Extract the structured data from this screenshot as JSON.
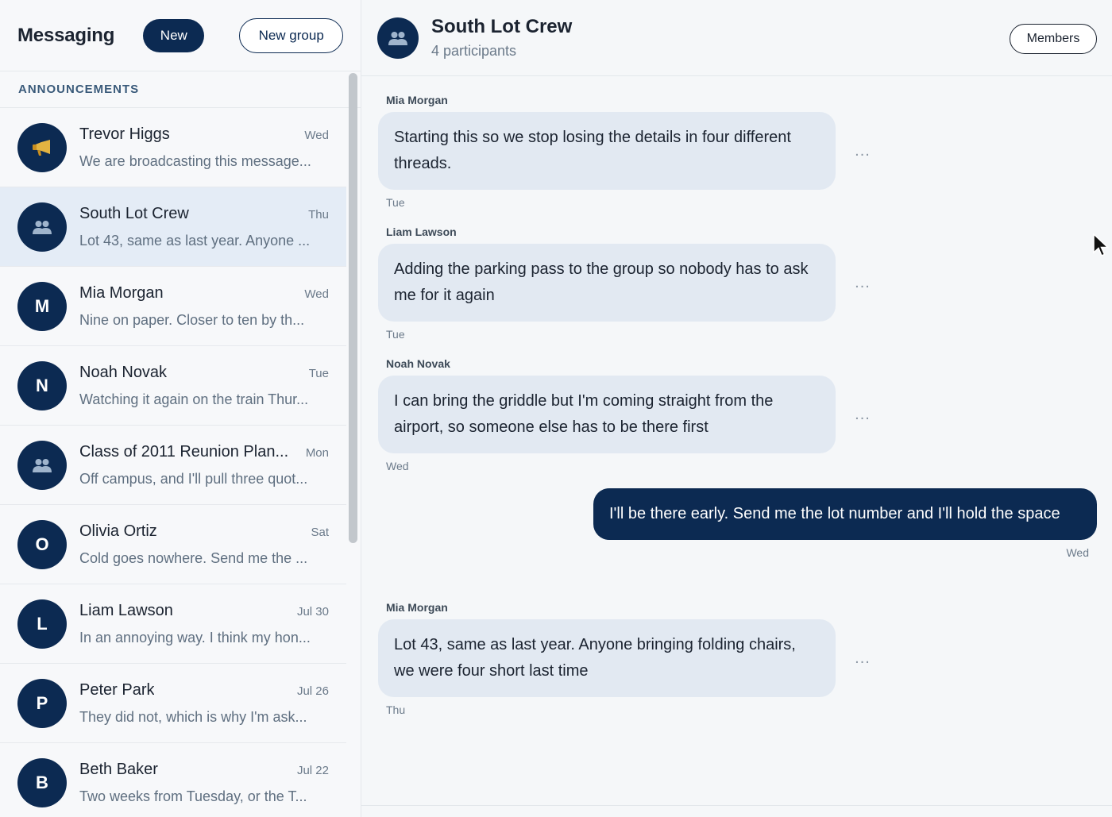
{
  "sidebar": {
    "title": "Messaging",
    "new_label": "New",
    "new_group_label": "New group",
    "section_label": "ANNOUNCEMENTS",
    "conversations": [
      {
        "name": "Trevor Higgs",
        "time": "Wed",
        "preview": "We are broadcasting this message...",
        "avatar": "megaphone-icon",
        "initial": ""
      },
      {
        "name": "South Lot Crew",
        "time": "Thu",
        "preview": "Lot 43, same as last year. Anyone ...",
        "avatar": "group-icon",
        "initial": "",
        "active": true
      },
      {
        "name": "Mia Morgan",
        "time": "Wed",
        "preview": "Nine on paper. Closer to ten by th...",
        "avatar": "letter",
        "initial": "M"
      },
      {
        "name": "Noah Novak",
        "time": "Tue",
        "preview": "Watching it again on the train Thur...",
        "avatar": "letter",
        "initial": "N"
      },
      {
        "name": "Class of 2011 Reunion Plan...",
        "time": "Mon",
        "preview": "Off campus, and I'll pull three quot...",
        "avatar": "group-icon",
        "initial": ""
      },
      {
        "name": "Olivia Ortiz",
        "time": "Sat",
        "preview": "Cold goes nowhere. Send me the ...",
        "avatar": "letter",
        "initial": "O"
      },
      {
        "name": "Liam Lawson",
        "time": "Jul 30",
        "preview": "In an annoying way. I think my hon...",
        "avatar": "letter",
        "initial": "L"
      },
      {
        "name": "Peter Park",
        "time": "Jul 26",
        "preview": "They did not, which is why I'm ask...",
        "avatar": "letter",
        "initial": "P"
      },
      {
        "name": "Beth Baker",
        "time": "Jul 22",
        "preview": "Two weeks from Tuesday, or the T...",
        "avatar": "letter",
        "initial": "B"
      }
    ]
  },
  "chat": {
    "title": "South Lot Crew",
    "subtitle": "4 participants",
    "members_label": "Members",
    "more_label": "...",
    "messages": [
      {
        "sender": "Mia Morgan",
        "text": "Starting this so we stop losing the details in four different threads.",
        "time": "Tue",
        "own": false
      },
      {
        "sender": "Liam Lawson",
        "text": "Adding the parking pass to the group so nobody has to ask me for it again",
        "time": "Tue",
        "own": false
      },
      {
        "sender": "Noah Novak",
        "text": "I can bring the griddle but I'm coming straight from the airport, so someone else has to be there first",
        "time": "Wed",
        "own": false
      },
      {
        "sender": "",
        "text": "I'll be there early. Send me the lot number and I'll hold the space",
        "time": "Wed",
        "own": true
      },
      {
        "sender": "Mia Morgan",
        "text": "Lot 43, same as last year. Anyone bringing folding chairs, we were four short last time",
        "time": "Thu",
        "own": false
      }
    ]
  },
  "colors": {
    "accent": "#0c2a52",
    "bubble_incoming": "#e2e9f2",
    "active_row": "#e4ecf6"
  }
}
